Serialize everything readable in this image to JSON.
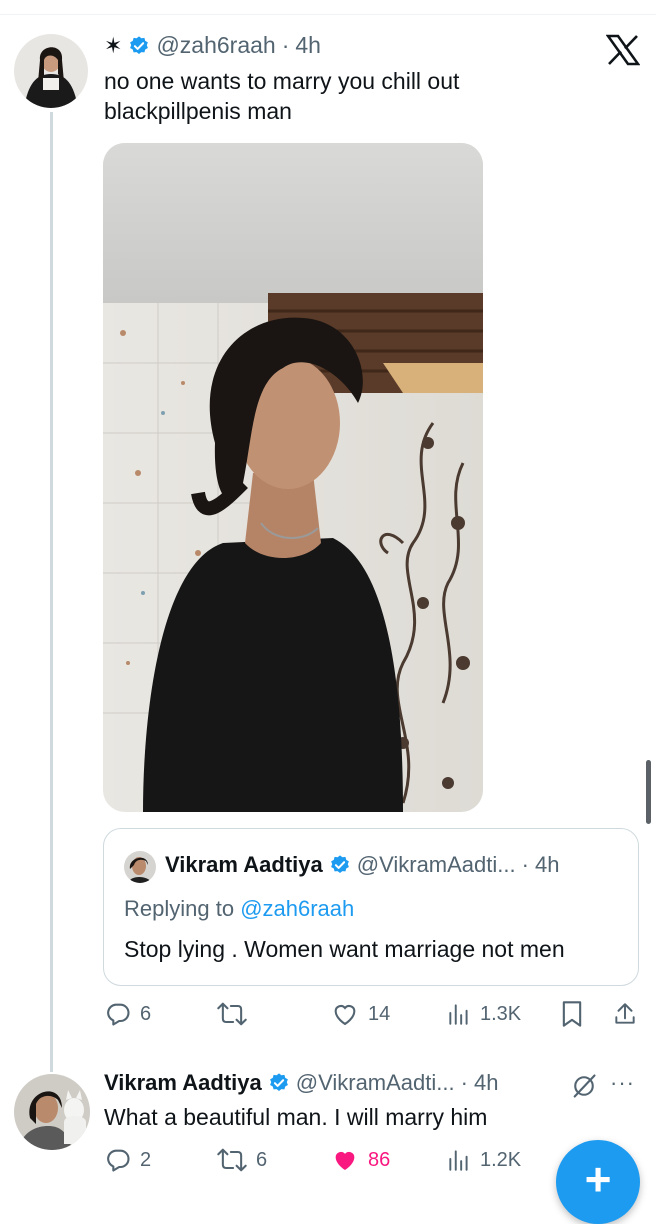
{
  "tweet": {
    "symbol": "✶",
    "handle": "@zah6raah",
    "time": "4h",
    "text_line1": "no one wants to marry you chill out",
    "text_line2": "blackpillpenis man"
  },
  "quote": {
    "name": "Vikram Aadtiya",
    "handle": "@VikramAadti...",
    "time": "4h",
    "replying_prefix": "Replying to ",
    "replying_handle": "@zah6raah",
    "text": "Stop lying . Women want marriage not men"
  },
  "tweet_actions": {
    "replies": "6",
    "likes": "14",
    "views": "1.3K"
  },
  "reply": {
    "name": "Vikram Aadtiya",
    "handle": "@VikramAadti...",
    "time": "4h",
    "text": "What a beautiful man. I will marry him",
    "more": "···",
    "actions": {
      "replies": "2",
      "reposts": "6",
      "likes": "86",
      "views": "1.2K"
    }
  },
  "colors": {
    "accent": "#1d9bf0",
    "like": "#f91880",
    "muted": "#536471"
  },
  "icons": [
    "x-logo-icon",
    "verified-badge-icon",
    "reply-icon",
    "repost-icon",
    "like-icon",
    "views-icon",
    "bookmark-icon",
    "share-icon",
    "grok-icon",
    "more-icon",
    "plus-icon"
  ]
}
